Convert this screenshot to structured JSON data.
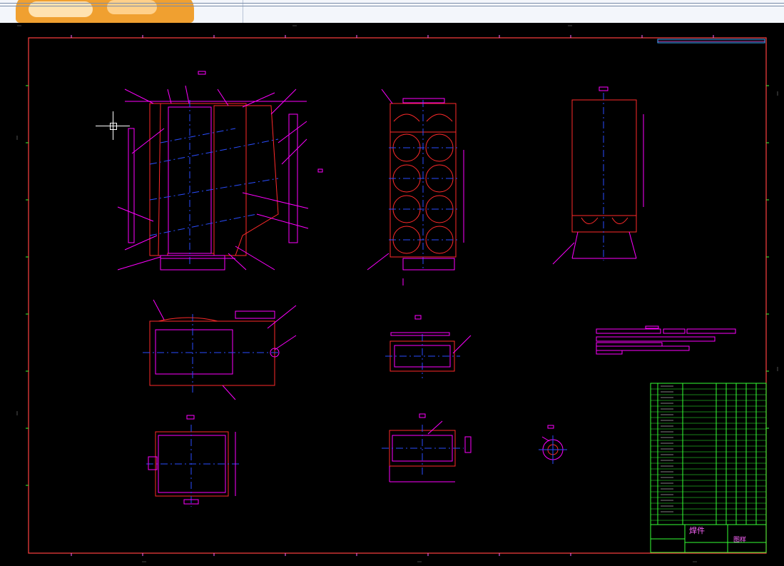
{
  "window": {
    "app": "CAD"
  },
  "drawing": {
    "title_block": {
      "part_name": "焊件",
      "sheet_label": "图样"
    },
    "colors": {
      "frame": "#ff4040",
      "parts": "#ff00ff",
      "outline": "#ff2a2a",
      "centerline": "#2a4dff",
      "table_lines": "#33ff33",
      "background": "#000000"
    },
    "icons": [
      "crosshair-cursor-icon"
    ]
  }
}
